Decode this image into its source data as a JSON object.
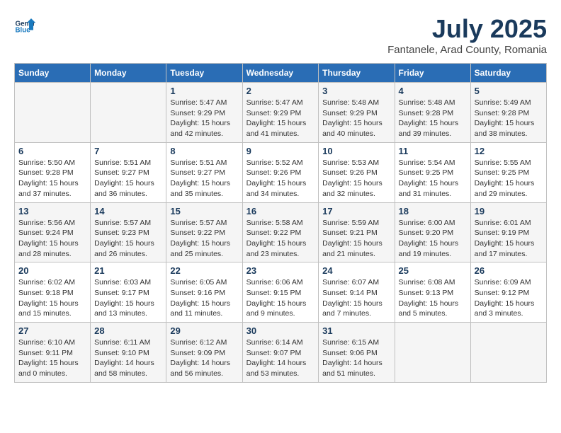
{
  "header": {
    "logo_general": "General",
    "logo_blue": "Blue",
    "title": "July 2025",
    "subtitle": "Fantanele, Arad County, Romania"
  },
  "weekdays": [
    "Sunday",
    "Monday",
    "Tuesday",
    "Wednesday",
    "Thursday",
    "Friday",
    "Saturday"
  ],
  "weeks": [
    [
      {
        "day": "",
        "detail": ""
      },
      {
        "day": "",
        "detail": ""
      },
      {
        "day": "1",
        "detail": "Sunrise: 5:47 AM\nSunset: 9:29 PM\nDaylight: 15 hours and 42 minutes."
      },
      {
        "day": "2",
        "detail": "Sunrise: 5:47 AM\nSunset: 9:29 PM\nDaylight: 15 hours and 41 minutes."
      },
      {
        "day": "3",
        "detail": "Sunrise: 5:48 AM\nSunset: 9:29 PM\nDaylight: 15 hours and 40 minutes."
      },
      {
        "day": "4",
        "detail": "Sunrise: 5:48 AM\nSunset: 9:28 PM\nDaylight: 15 hours and 39 minutes."
      },
      {
        "day": "5",
        "detail": "Sunrise: 5:49 AM\nSunset: 9:28 PM\nDaylight: 15 hours and 38 minutes."
      }
    ],
    [
      {
        "day": "6",
        "detail": "Sunrise: 5:50 AM\nSunset: 9:28 PM\nDaylight: 15 hours and 37 minutes."
      },
      {
        "day": "7",
        "detail": "Sunrise: 5:51 AM\nSunset: 9:27 PM\nDaylight: 15 hours and 36 minutes."
      },
      {
        "day": "8",
        "detail": "Sunrise: 5:51 AM\nSunset: 9:27 PM\nDaylight: 15 hours and 35 minutes."
      },
      {
        "day": "9",
        "detail": "Sunrise: 5:52 AM\nSunset: 9:26 PM\nDaylight: 15 hours and 34 minutes."
      },
      {
        "day": "10",
        "detail": "Sunrise: 5:53 AM\nSunset: 9:26 PM\nDaylight: 15 hours and 32 minutes."
      },
      {
        "day": "11",
        "detail": "Sunrise: 5:54 AM\nSunset: 9:25 PM\nDaylight: 15 hours and 31 minutes."
      },
      {
        "day": "12",
        "detail": "Sunrise: 5:55 AM\nSunset: 9:25 PM\nDaylight: 15 hours and 29 minutes."
      }
    ],
    [
      {
        "day": "13",
        "detail": "Sunrise: 5:56 AM\nSunset: 9:24 PM\nDaylight: 15 hours and 28 minutes."
      },
      {
        "day": "14",
        "detail": "Sunrise: 5:57 AM\nSunset: 9:23 PM\nDaylight: 15 hours and 26 minutes."
      },
      {
        "day": "15",
        "detail": "Sunrise: 5:57 AM\nSunset: 9:22 PM\nDaylight: 15 hours and 25 minutes."
      },
      {
        "day": "16",
        "detail": "Sunrise: 5:58 AM\nSunset: 9:22 PM\nDaylight: 15 hours and 23 minutes."
      },
      {
        "day": "17",
        "detail": "Sunrise: 5:59 AM\nSunset: 9:21 PM\nDaylight: 15 hours and 21 minutes."
      },
      {
        "day": "18",
        "detail": "Sunrise: 6:00 AM\nSunset: 9:20 PM\nDaylight: 15 hours and 19 minutes."
      },
      {
        "day": "19",
        "detail": "Sunrise: 6:01 AM\nSunset: 9:19 PM\nDaylight: 15 hours and 17 minutes."
      }
    ],
    [
      {
        "day": "20",
        "detail": "Sunrise: 6:02 AM\nSunset: 9:18 PM\nDaylight: 15 hours and 15 minutes."
      },
      {
        "day": "21",
        "detail": "Sunrise: 6:03 AM\nSunset: 9:17 PM\nDaylight: 15 hours and 13 minutes."
      },
      {
        "day": "22",
        "detail": "Sunrise: 6:05 AM\nSunset: 9:16 PM\nDaylight: 15 hours and 11 minutes."
      },
      {
        "day": "23",
        "detail": "Sunrise: 6:06 AM\nSunset: 9:15 PM\nDaylight: 15 hours and 9 minutes."
      },
      {
        "day": "24",
        "detail": "Sunrise: 6:07 AM\nSunset: 9:14 PM\nDaylight: 15 hours and 7 minutes."
      },
      {
        "day": "25",
        "detail": "Sunrise: 6:08 AM\nSunset: 9:13 PM\nDaylight: 15 hours and 5 minutes."
      },
      {
        "day": "26",
        "detail": "Sunrise: 6:09 AM\nSunset: 9:12 PM\nDaylight: 15 hours and 3 minutes."
      }
    ],
    [
      {
        "day": "27",
        "detail": "Sunrise: 6:10 AM\nSunset: 9:11 PM\nDaylight: 15 hours and 0 minutes."
      },
      {
        "day": "28",
        "detail": "Sunrise: 6:11 AM\nSunset: 9:10 PM\nDaylight: 14 hours and 58 minutes."
      },
      {
        "day": "29",
        "detail": "Sunrise: 6:12 AM\nSunset: 9:09 PM\nDaylight: 14 hours and 56 minutes."
      },
      {
        "day": "30",
        "detail": "Sunrise: 6:14 AM\nSunset: 9:07 PM\nDaylight: 14 hours and 53 minutes."
      },
      {
        "day": "31",
        "detail": "Sunrise: 6:15 AM\nSunset: 9:06 PM\nDaylight: 14 hours and 51 minutes."
      },
      {
        "day": "",
        "detail": ""
      },
      {
        "day": "",
        "detail": ""
      }
    ]
  ]
}
